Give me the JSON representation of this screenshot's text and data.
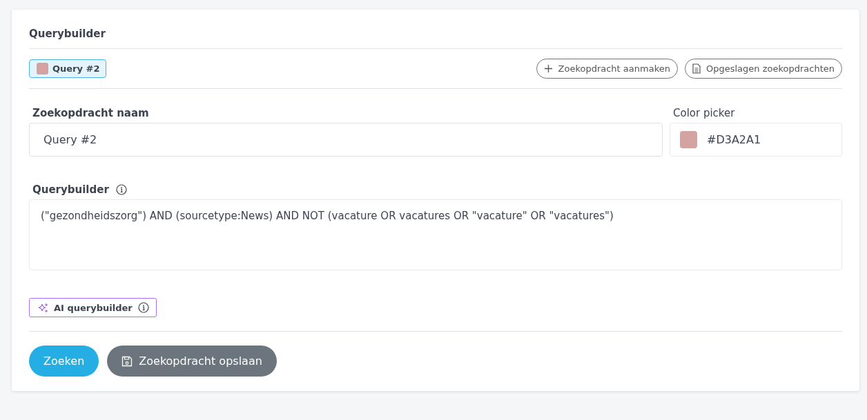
{
  "card": {
    "title": "Querybuilder"
  },
  "query_tabs": [
    {
      "label": "Query #2",
      "color": "#d3a2a1",
      "selected": true
    }
  ],
  "toolbar_buttons": [
    {
      "kind": "create",
      "label": "Zoekopdracht aanmaken"
    },
    {
      "kind": "saved",
      "label": "Opgeslagen zoekopdrachten"
    }
  ],
  "name_field": {
    "label": "Zoekopdracht naam",
    "value": "Query #2"
  },
  "color_picker": {
    "label": "Color picker",
    "value": "#D3A2A1",
    "color": "#d3a2a1"
  },
  "querybuilder": {
    "label": "Querybuilder",
    "value": "(\"gezondheidszorg\") AND (sourcetype:News) AND NOT (vacature OR vacatures OR \"vacature\" OR \"vacatures\")"
  },
  "ai_button": {
    "label": "AI querybuilder"
  },
  "actions": [
    {
      "kind": "primary",
      "label": "Zoeken"
    },
    {
      "kind": "save",
      "label": "Zoekopdracht opslaan"
    }
  ]
}
